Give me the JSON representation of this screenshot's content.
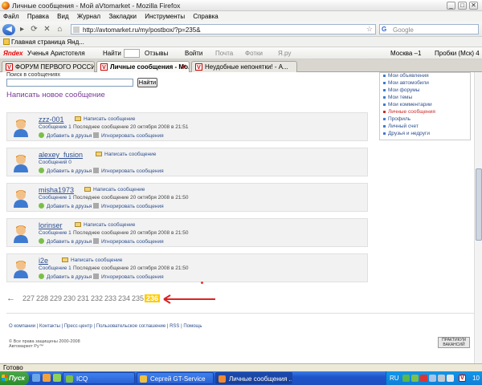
{
  "window": {
    "title": "Личные сообщения - Мой aVtomarket - Mozilla Firefox",
    "minimize": "_",
    "maximize": "□",
    "close": "✕"
  },
  "menu": [
    "Файл",
    "Правка",
    "Вид",
    "Журнал",
    "Закладки",
    "Инструменты",
    "Справка"
  ],
  "nav": {
    "back_icon": "arrow-left-icon",
    "forward_icon": "arrow-right-icon",
    "url": "http://avtomarket.ru/my/postbox/?p=235&",
    "search_engine": "G",
    "search_placeholder": "Google"
  },
  "bookmarks": {
    "item1": "Главная страница Янд..."
  },
  "yandex_bar": {
    "logo": "Яndex",
    "aristotle": "Ученья Аристотеля",
    "find": "Найти",
    "reviews": "Отзывы",
    "login": "Войти",
    "mail": "Почта",
    "photos": "Фотки",
    "yaru": "Я.ру",
    "city": "Москва –1",
    "traffic": "Пробки (Мск) 4"
  },
  "tabs": [
    {
      "label": "ФОРУМ ПЕРВОГО РОССИЙ...",
      "active": false
    },
    {
      "label": "Личные сообщения - Мо...",
      "active": true
    },
    {
      "label": "Неудобные непонятки! - А...",
      "active": false
    }
  ],
  "search": {
    "label": "Поиск в сообщениях",
    "button": "Найти"
  },
  "new_message_link": "Написать новое сообщение",
  "threads": [
    {
      "user": "zzz-001",
      "write": "Написать сообщение",
      "count": "Сообщение 1",
      "last": "Последнее сообщение 20 октября 2008 в 21:51",
      "add": "Добавить в друзья",
      "ignore": "Игнорировать сообщения"
    },
    {
      "user": "alexey_fusion",
      "write": "Написать сообщение",
      "count": "Сообщений 0",
      "last": "",
      "add": "Добавить в друзья",
      "ignore": "Игнорировать сообщения"
    },
    {
      "user": "misha1973",
      "write": "Написать сообщение",
      "count": "Сообщение 1",
      "last": "Последнее сообщение 20 октября 2008 в 21:50",
      "add": "Добавить в друзья",
      "ignore": "Игнорировать сообщения"
    },
    {
      "user": "lorinser",
      "write": "Написать сообщение",
      "count": "Сообщение 1",
      "last": "Последнее сообщение 20 октября 2008 в 21:50",
      "add": "Добавить в друзья",
      "ignore": "Игнорировать сообщения"
    },
    {
      "user": "i2e",
      "write": "Написать сообщение",
      "count": "Сообщение 1",
      "last": "Последнее сообщение 20 октября 2008 в 21:50",
      "add": "Добавить в друзья",
      "ignore": "Игнорировать сообщения"
    }
  ],
  "right_menu": [
    {
      "label": "Мои объявления",
      "active": false
    },
    {
      "label": "Мои автомобили",
      "active": false
    },
    {
      "label": "Мои форумы",
      "active": false
    },
    {
      "label": "Мои темы",
      "active": false
    },
    {
      "label": "Мои комментарии",
      "active": false
    },
    {
      "label": "Личные сообщения",
      "active": true
    },
    {
      "label": "Профиль",
      "active": false
    },
    {
      "label": "Личный счет",
      "active": false
    },
    {
      "label": "Друзья и недруги",
      "active": false
    }
  ],
  "pager": {
    "prev": "←",
    "pages": [
      "227",
      "228",
      "229",
      "230",
      "231",
      "232",
      "233",
      "234",
      "235",
      "236"
    ],
    "current": "236"
  },
  "footer": {
    "links": "О компании | Контакты | Пресс-центр | Пользовательское соглашение | RSS | Помощь",
    "copyright": "© Все права защищены 2000-2008",
    "copyright2": "Автомаркет Ру™",
    "counter": "ПРАКТИКУМ ВАКАНСИЙ"
  },
  "status": "Готово",
  "taskbar": {
    "start": "Пуск",
    "tasks": [
      {
        "label": "ICQ",
        "active": false
      },
      {
        "label": "Сергей GT-Service",
        "active": false
      },
      {
        "label": "Личные сообщения ...",
        "active": true
      }
    ],
    "lang": "RU",
    "clock": "10"
  }
}
